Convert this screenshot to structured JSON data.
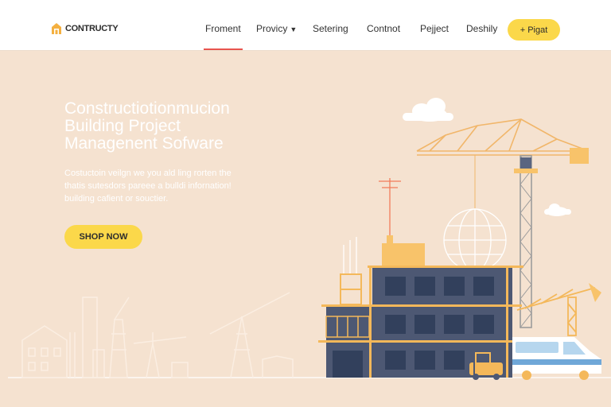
{
  "brand": {
    "name": "CONTRUCTY",
    "icon": "building-logo-icon"
  },
  "nav": {
    "items": [
      {
        "label": "Froment",
        "active": true
      },
      {
        "label": "Provicy",
        "dropdown": true
      },
      {
        "label": "Setering"
      },
      {
        "label": "Contnot"
      },
      {
        "label": "Pejject"
      },
      {
        "label": "Deshily"
      }
    ],
    "cta_label": "+ Pigat"
  },
  "hero": {
    "title_lines": [
      "Constructiotionmucion",
      "Building Project",
      "Managenent Sofware"
    ],
    "description_lines": [
      "Costuctoin veilgn we you ald ling rorten the",
      "thatis sutesdors pareee a bulldi infornation!",
      "building cafient or souctier."
    ],
    "button_label": "SHOP NOW"
  },
  "colors": {
    "background": "#f5e2d0",
    "accent_yellow": "#fbd84a",
    "crane": "#f4b85a",
    "building": "#4d5873",
    "nav_underline": "#e8554e"
  }
}
